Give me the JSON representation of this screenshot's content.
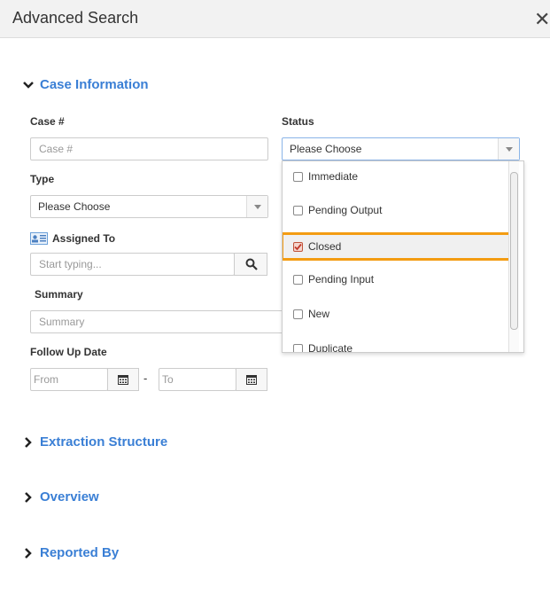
{
  "header": {
    "title": "Advanced Search",
    "close_label": "✕"
  },
  "sections": {
    "case_information": "Case Information",
    "extraction_structure": "Extraction Structure",
    "overview": "Overview",
    "reported_by": "Reported By"
  },
  "fields": {
    "case_number": {
      "label": "Case #",
      "placeholder": "Case #",
      "value": ""
    },
    "status": {
      "label": "Status",
      "value": "Please Choose"
    },
    "type": {
      "label": "Type",
      "value": "Please Choose"
    },
    "assigned_to": {
      "label": "Assigned To",
      "placeholder": "Start typing..."
    },
    "summary": {
      "label": "Summary",
      "placeholder": "Summary"
    },
    "follow_up_date": {
      "label": "Follow Up Date",
      "from_placeholder": "From",
      "to_placeholder": "To",
      "separator": "-"
    }
  },
  "status_options": [
    {
      "label": "Immediate",
      "checked": false
    },
    {
      "label": "Pending Output",
      "checked": false
    },
    {
      "label": "Closed",
      "checked": true
    },
    {
      "label": "Pending Input",
      "checked": false
    },
    {
      "label": "New",
      "checked": false
    },
    {
      "label": "Duplicate",
      "checked": false
    }
  ],
  "colors": {
    "accent": "#3a7fd5",
    "highlight": "#f39c12"
  }
}
